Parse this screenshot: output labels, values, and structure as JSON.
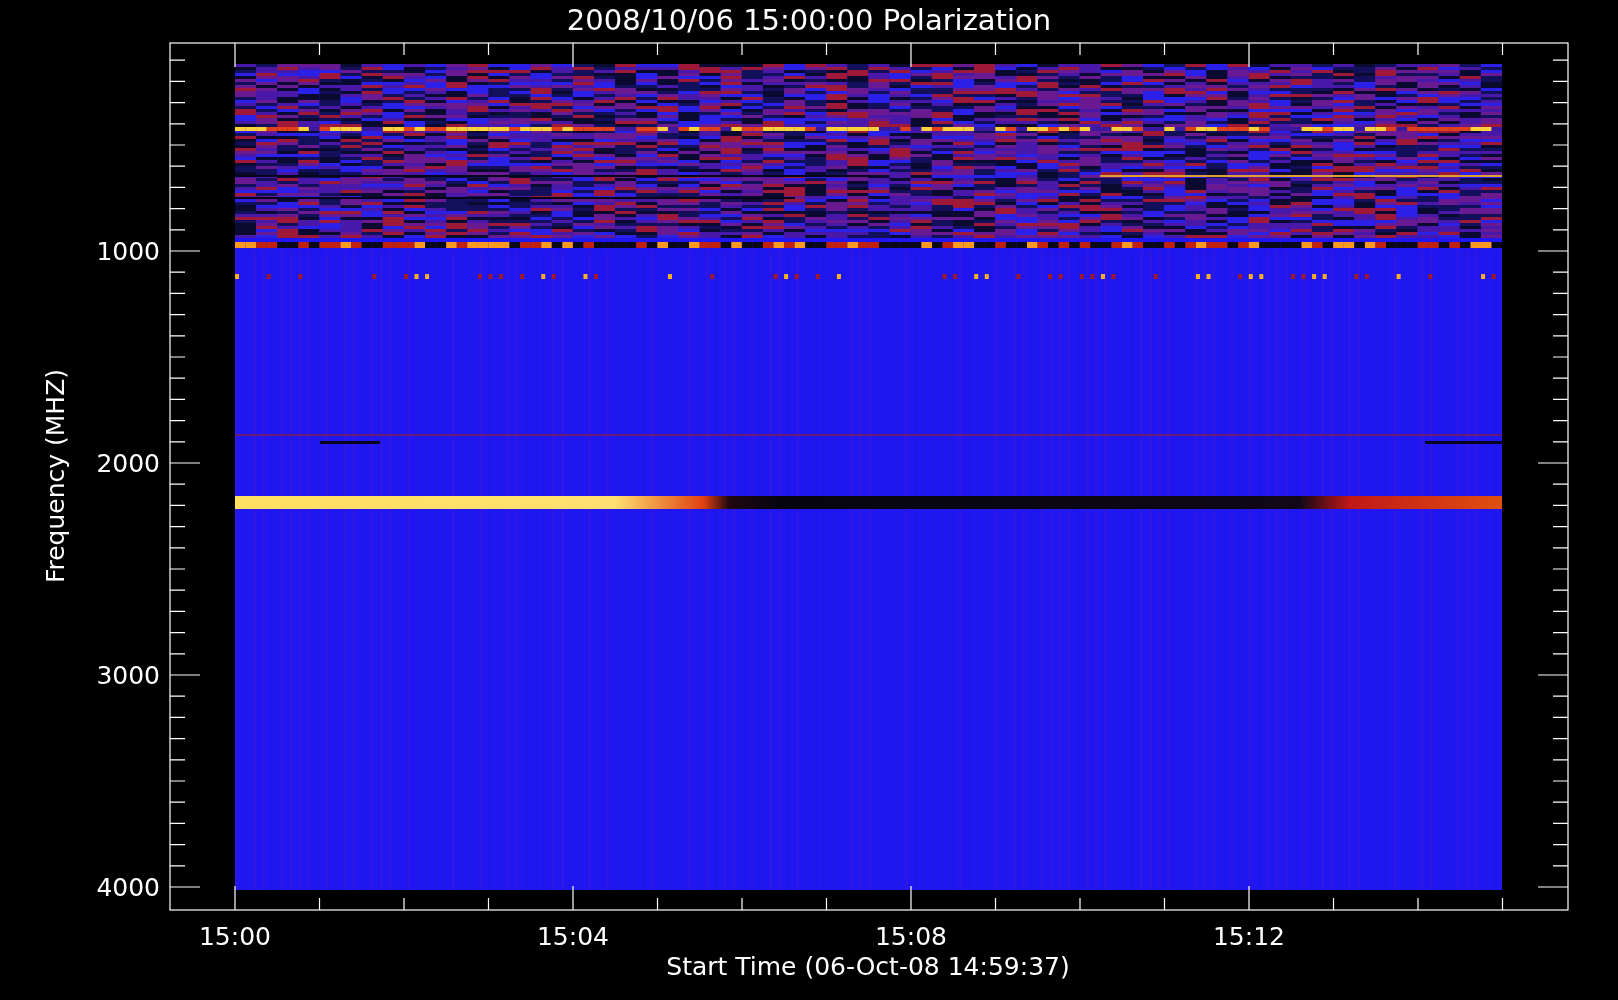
{
  "title": "2008/10/06 15:00:00 Polarization",
  "y_axis": {
    "label": "Frequency (MHZ)",
    "ticks": [
      "1000",
      "2000",
      "3000",
      "4000"
    ]
  },
  "x_axis": {
    "label": "Start Time (06-Oct-08 14:59:37)",
    "ticks": [
      "15:00",
      "15:04",
      "15:08",
      "15:12"
    ]
  }
}
